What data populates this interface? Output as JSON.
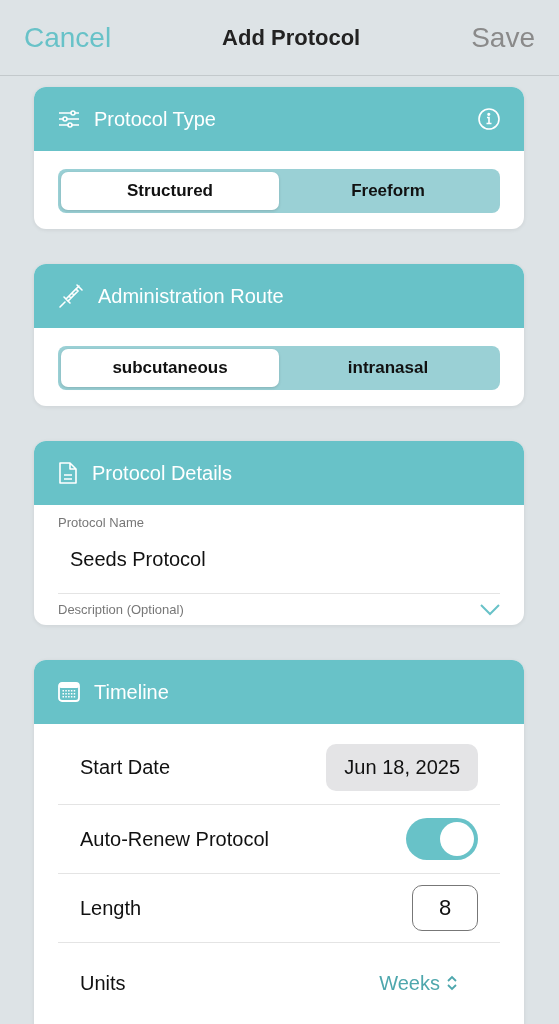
{
  "nav": {
    "cancel": "Cancel",
    "title": "Add Protocol",
    "save": "Save"
  },
  "sections": [
    {
      "kind": "segmented",
      "title": "Protocol Type",
      "has_info": true,
      "options": [
        {
          "label": "Structured",
          "selected": true
        },
        {
          "label": "Freeform",
          "selected": false
        }
      ]
    },
    {
      "kind": "segmented",
      "title": "Administration Route",
      "has_info": false,
      "options": [
        {
          "label": "subcutaneous",
          "selected": true
        },
        {
          "label": "intranasal",
          "selected": false
        }
      ]
    },
    {
      "kind": "details",
      "title": "Protocol Details",
      "name_label": "Protocol Name",
      "name_value": "Seeds Protocol",
      "description_label": "Description (Optional)",
      "description_expanded": false
    },
    {
      "kind": "timeline",
      "title": "Timeline",
      "rows": [
        {
          "kind": "date",
          "label": "Start Date",
          "value": "Jun 18, 2025"
        },
        {
          "kind": "toggle",
          "label": "Auto-Renew Protocol",
          "on": true
        },
        {
          "kind": "number",
          "label": "Length",
          "value": "8"
        },
        {
          "kind": "picker",
          "label": "Units",
          "value": "Weeks"
        }
      ]
    }
  ]
}
